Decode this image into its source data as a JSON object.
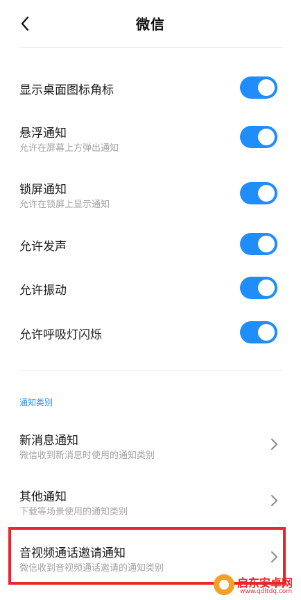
{
  "header": {
    "title": "微信",
    "back_icon": "chevron-left-icon"
  },
  "toggles": [
    {
      "title": "显示桌面图标角标",
      "subtitle": "",
      "enabled": true
    },
    {
      "title": "悬浮通知",
      "subtitle": "允许在屏幕上方弹出通知",
      "enabled": true
    },
    {
      "title": "锁屏通知",
      "subtitle": "允许在锁屏上显示通知",
      "enabled": true
    },
    {
      "title": "允许发声",
      "subtitle": "",
      "enabled": true
    },
    {
      "title": "允许振动",
      "subtitle": "",
      "enabled": true
    },
    {
      "title": "允许呼吸灯闪烁",
      "subtitle": "",
      "enabled": true
    }
  ],
  "categories": {
    "section_label": "通知类别",
    "items": [
      {
        "title": "新消息通知",
        "subtitle": "微信收到新消息时使用的通知类别"
      },
      {
        "title": "其他通知",
        "subtitle": "下载等场景使用的通知类别"
      },
      {
        "title": "音视频通话邀请通知",
        "subtitle": "微信收到音视频通话邀请的通知类别"
      }
    ]
  },
  "colors": {
    "accent": "#1f8dfa",
    "section_label": "#2d8cf0",
    "highlight": "#e8262c"
  },
  "watermark": {
    "title": "启东安卓网",
    "url": "www.qdltdq.com"
  }
}
